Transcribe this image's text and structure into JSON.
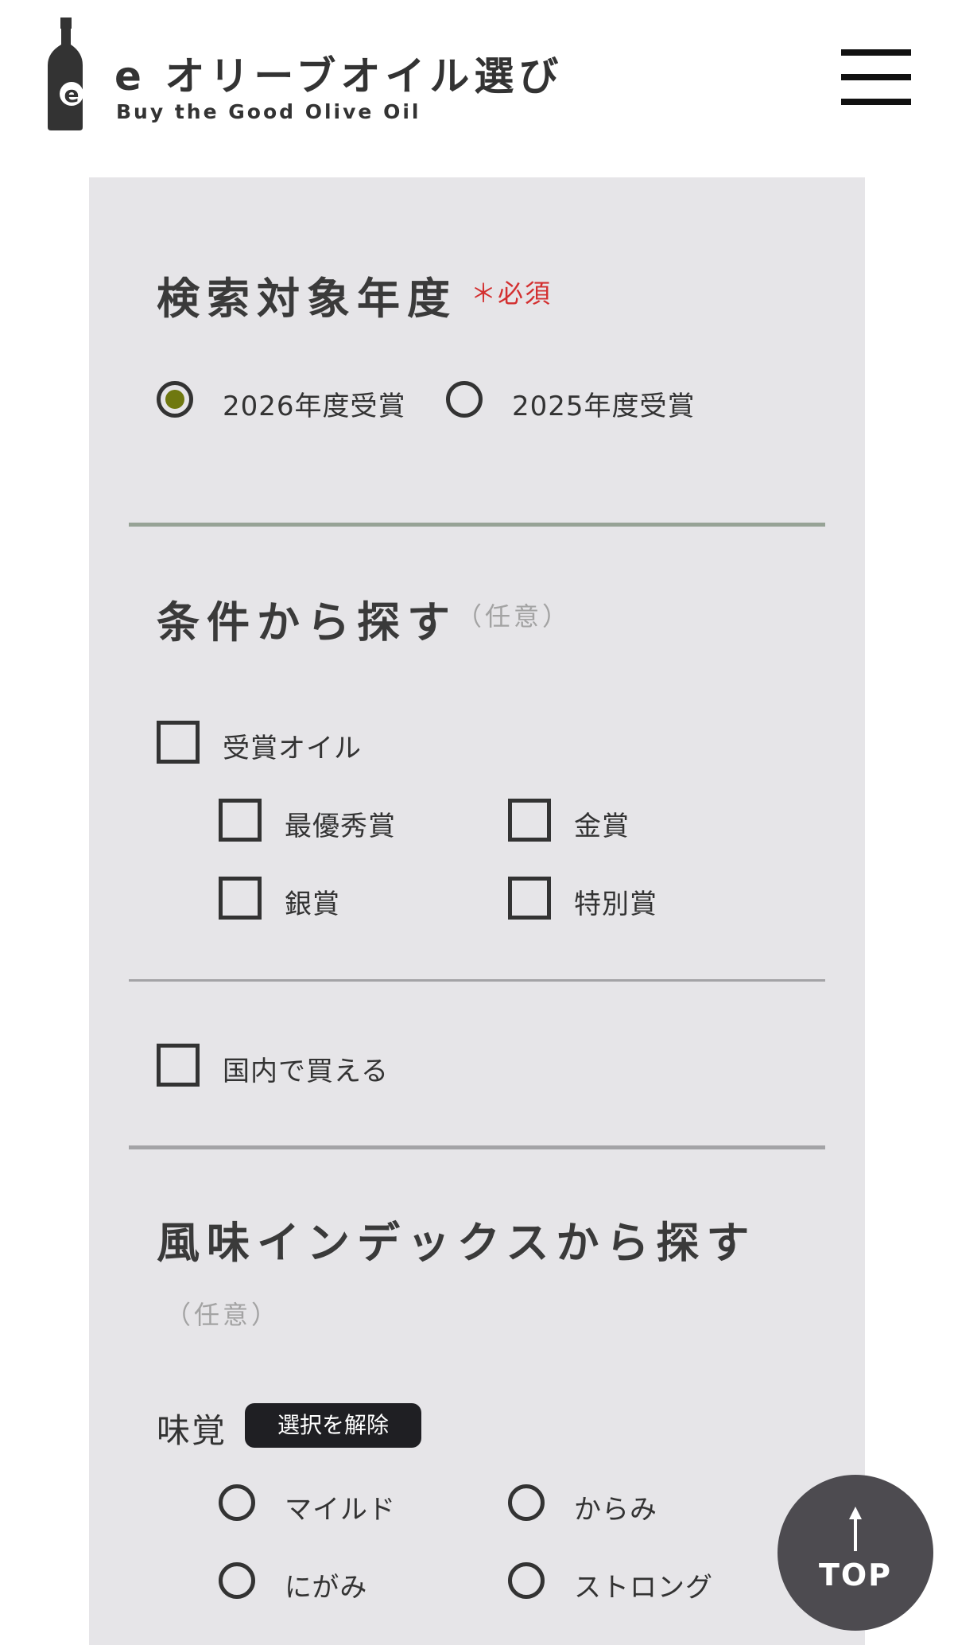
{
  "header": {
    "title": "e オリーブオイル選び",
    "subtitle": "Buy the Good Olive Oil",
    "logo_letter": "e",
    "menu_icon": "hamburger-menu-icon"
  },
  "year_section": {
    "title": "検索対象年度",
    "required_label": "＊必須",
    "options": [
      {
        "label": "2026年度受賞",
        "checked": true
      },
      {
        "label": "2025年度受賞",
        "checked": false
      }
    ]
  },
  "conditions_section": {
    "title": "条件から探す",
    "optional_label": "（任意）",
    "award_oil": {
      "label": "受賞オイル",
      "checked": false
    },
    "awards": [
      {
        "label": "最優秀賞",
        "checked": false
      },
      {
        "label": "金賞",
        "checked": false
      },
      {
        "label": "銀賞",
        "checked": false
      },
      {
        "label": "特別賞",
        "checked": false
      }
    ],
    "domestic": {
      "label": "国内で買える",
      "checked": false
    }
  },
  "flavor_section": {
    "title": "風味インデックスから探す",
    "optional_label": "（任意）",
    "taste_label": "味覚",
    "clear_button": "選択を解除",
    "taste_options": [
      {
        "label": "マイルド",
        "checked": false
      },
      {
        "label": "からみ",
        "checked": false
      },
      {
        "label": "にがみ",
        "checked": false
      },
      {
        "label": "ストロング",
        "checked": false
      }
    ]
  },
  "top_button": {
    "label": "TOP",
    "icon": "arrow-up-icon"
  },
  "colors": {
    "panel_bg": "#e6e5e8",
    "accent_radio": "#6f7810",
    "required": "#d32f2f",
    "dark_button": "#1f1f23",
    "top_button": "#4d4b50"
  }
}
